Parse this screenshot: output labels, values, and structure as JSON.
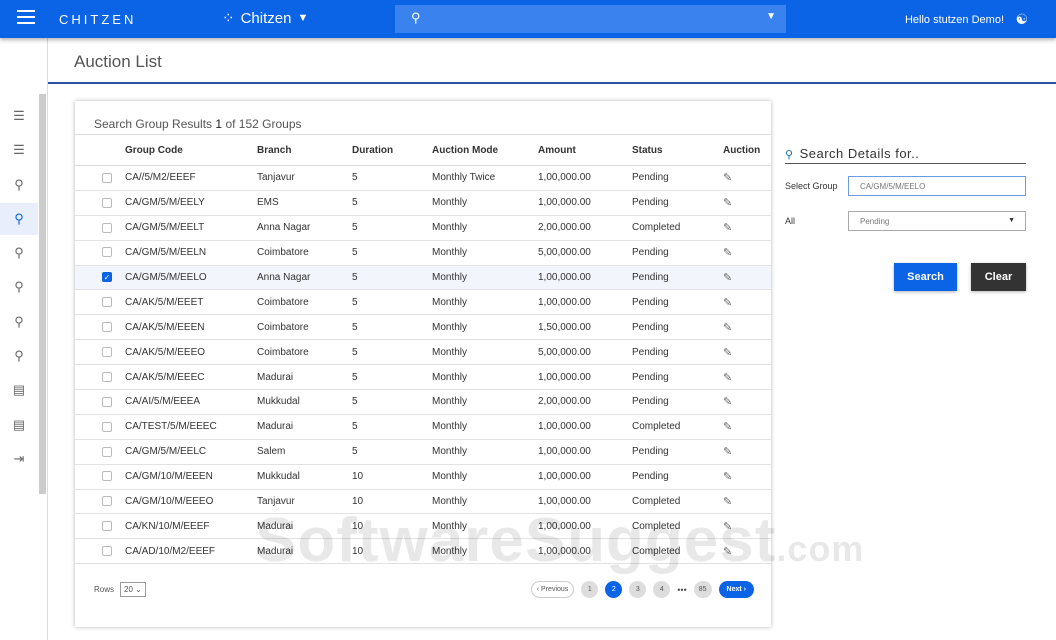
{
  "topbar": {
    "brand": "CHITZEN",
    "org": "Chitzen",
    "greeting": "Hello stutzen Demo!"
  },
  "page": {
    "title": "Auction List"
  },
  "results": {
    "prefix": "Search Group Results",
    "current": "1",
    "of": "of",
    "total": "152 Groups"
  },
  "table": {
    "headers": [
      "Group Code",
      "Branch",
      "Duration",
      "Auction Mode",
      "Amount",
      "Status",
      "Auction"
    ],
    "rows": [
      [
        "CA//5/M2/EEEF",
        "Tanjavur",
        "5",
        "Monthly Twice",
        "1,00,000.00",
        "Pending"
      ],
      [
        "CA/GM/5/M/EELY",
        "EMS",
        "5",
        "Monthly",
        "1,00,000.00",
        "Pending"
      ],
      [
        "CA/GM/5/M/EELT",
        "Anna Nagar",
        "5",
        "Monthly",
        "2,00,000.00",
        "Completed"
      ],
      [
        "CA/GM/5/M/EELN",
        "Coimbatore",
        "5",
        "Monthly",
        "5,00,000.00",
        "Pending"
      ],
      [
        "CA/GM/5/M/EELO",
        "Anna Nagar",
        "5",
        "Monthly",
        "1,00,000.00",
        "Pending"
      ],
      [
        "CA/AK/5/M/EEET",
        "Coimbatore",
        "5",
        "Monthly",
        "1,00,000.00",
        "Pending"
      ],
      [
        "CA/AK/5/M/EEEN",
        "Coimbatore",
        "5",
        "Monthly",
        "1,50,000.00",
        "Pending"
      ],
      [
        "CA/AK/5/M/EEEO",
        "Coimbatore",
        "5",
        "Monthly",
        "5,00,000.00",
        "Pending"
      ],
      [
        "CA/AK/5/M/EEEC",
        "Madurai",
        "5",
        "Monthly",
        "1,00,000.00",
        "Pending"
      ],
      [
        "CA/AI/5/M/EEEA",
        "Mukkudal",
        "5",
        "Monthly",
        "2,00,000.00",
        "Pending"
      ],
      [
        "CA/TEST/5/M/EEEC",
        "Madurai",
        "5",
        "Monthly",
        "1,00,000.00",
        "Completed"
      ],
      [
        "CA/GM/5/M/EELC",
        "Salem",
        "5",
        "Monthly",
        "1,00,000.00",
        "Pending"
      ],
      [
        "CA/GM/10/M/EEEN",
        "Mukkudal",
        "10",
        "Monthly",
        "1,00,000.00",
        "Pending"
      ],
      [
        "CA/GM/10/M/EEEO",
        "Tanjavur",
        "10",
        "Monthly",
        "1,00,000.00",
        "Completed"
      ],
      [
        "CA/KN/10/M/EEEF",
        "Madurai",
        "10",
        "Monthly",
        "1,00,000.00",
        "Completed"
      ],
      [
        "CA/AD/10/M2/EEEF",
        "Madurai",
        "10",
        "Monthly",
        "1,00,000.00",
        "Completed"
      ]
    ],
    "selected_row": 4
  },
  "footer": {
    "rows_label": "Rows",
    "rows_value": "20",
    "previous": "Previous",
    "pages": [
      "1",
      "2",
      "3",
      "4"
    ],
    "ellipsis": "•••",
    "last": "85",
    "current_page": "2",
    "next": "Next"
  },
  "panel": {
    "title": "Search Details for..",
    "group_label": "Select Group",
    "group_value": "CA/GM/5/M/EELO",
    "status_label": "All",
    "status_value": "Pending",
    "search": "Search",
    "clear": "Clear"
  },
  "watermark": "SoftwareSuggest",
  "colors": {
    "primary": "#0b63e5",
    "dark": "#333333"
  }
}
